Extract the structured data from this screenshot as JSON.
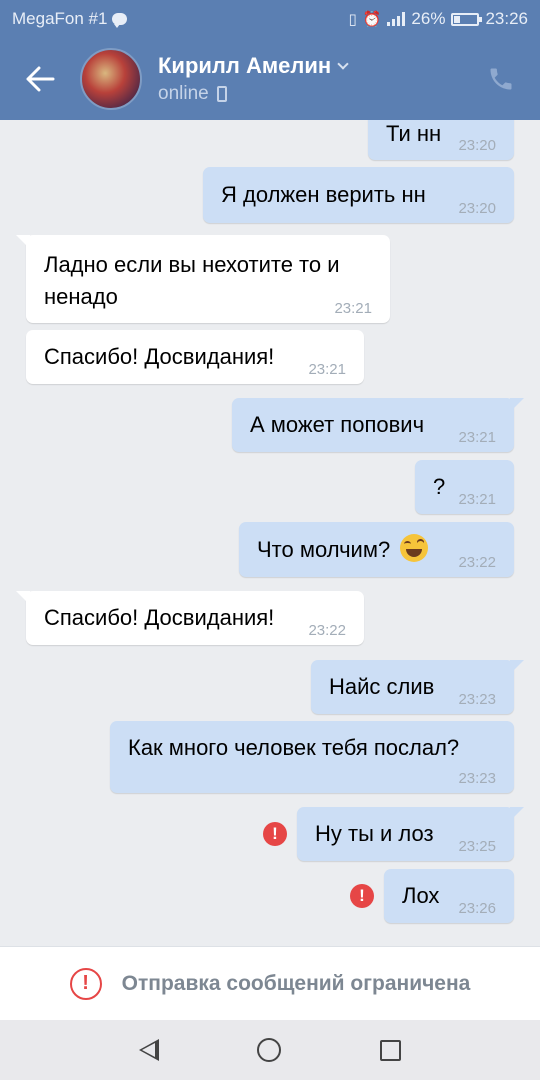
{
  "status_bar": {
    "carrier": "MegaFon #1",
    "battery_percent": "26%",
    "battery_level": 0.26,
    "time": "23:26"
  },
  "header": {
    "contact_name": "Кирилл Амелин",
    "status": "online"
  },
  "messages": [
    {
      "direction": "out",
      "text": "Ти нн",
      "time": "23:20"
    },
    {
      "direction": "out",
      "text": "Я должен верить нн",
      "time": "23:20"
    },
    {
      "direction": "in",
      "text_line1": "Ладно если вы нехотите  то и",
      "text_line2": "ненадо",
      "time": "23:21"
    },
    {
      "direction": "in",
      "text": "Спасибо! Досвидания!",
      "time": "23:21"
    },
    {
      "direction": "out",
      "text": "А может попович",
      "time": "23:21"
    },
    {
      "direction": "out",
      "text": "?",
      "time": "23:21"
    },
    {
      "direction": "out",
      "text": "Что молчим?",
      "emoji": "laughing-emoji",
      "time": "23:22"
    },
    {
      "direction": "in",
      "text": "Спасибо! Досвидания!",
      "time": "23:22"
    },
    {
      "direction": "out",
      "text": "Найс слив",
      "time": "23:23"
    },
    {
      "direction": "out",
      "text": "Как много человек тебя послал?",
      "time": "23:23"
    },
    {
      "direction": "out",
      "text": "Ну ты и лоз",
      "time": "23:25",
      "failed": true
    },
    {
      "direction": "out",
      "text": "Лох",
      "time": "23:26",
      "failed": true
    }
  ],
  "restricted_bar": {
    "text": "Отправка сообщений ограничена"
  },
  "colors": {
    "header_bg": "#5b7fb2",
    "outgoing_bubble": "#ccdef5",
    "incoming_bubble": "#ffffff",
    "error_red": "#e64646",
    "chat_bg": "#ebedf0"
  },
  "icons": {
    "back": "arrow-left-icon",
    "call": "phone-icon",
    "error": "exclamation-icon",
    "nav_back": "triangle-back-icon",
    "nav_home": "circle-home-icon",
    "nav_recent": "square-recent-icon"
  }
}
